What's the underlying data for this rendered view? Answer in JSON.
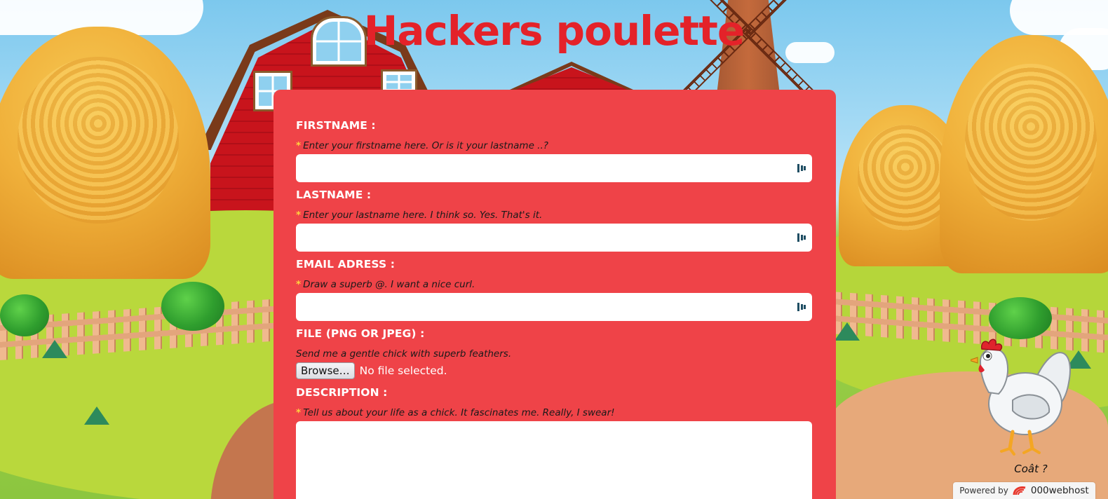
{
  "header": {
    "title": "Hackers poulette"
  },
  "form": {
    "firstname": {
      "label": "FIRSTNAME :",
      "required_mark": "*",
      "hint": "Enter your firstname here. Or is it your lastname ..?",
      "value": ""
    },
    "lastname": {
      "label": "LASTNAME :",
      "required_mark": "*",
      "hint": "Enter your lastname here. I think so. Yes. That's it.",
      "value": ""
    },
    "email": {
      "label": "EMAIL ADRESS :",
      "required_mark": "*",
      "hint": "Draw a superb @. I want a nice curl.",
      "value": ""
    },
    "file": {
      "label": "FILE (PNG OR JPEG) :",
      "hint": "Send me a gentle chick with superb feathers.",
      "button_label": "Browse…",
      "status": "No file selected."
    },
    "description": {
      "label": "DESCRIPTION :",
      "required_mark": "*",
      "hint": "Tell us about your life as a chick. It fascinates me. Really, I swear!",
      "value": ""
    }
  },
  "mascot": {
    "caption": "Coât ?"
  },
  "footer": {
    "powered_by": "Powered by",
    "brand": "000webhost"
  },
  "colors": {
    "title": "#e42229",
    "card_bg": "#ef4348",
    "label": "#ffffff",
    "required_mark": "#ffd23f"
  },
  "icons": [
    "password-manager-icon",
    "000webhost-logo-icon",
    "chicken-illustration"
  ]
}
